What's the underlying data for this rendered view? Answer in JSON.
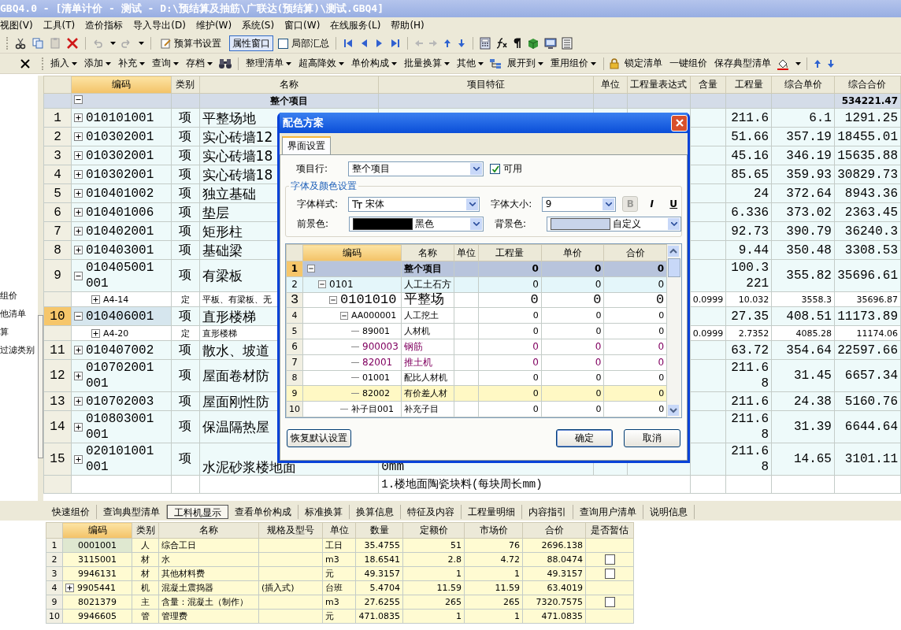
{
  "window": {
    "title": "GBQ4.0 - [清单计价 - 测试 - D:\\预结算及抽筋\\广联达(预结算)\\测试.GBQ4]"
  },
  "menu": [
    "视图(V)",
    "工具(T)",
    "造价指标",
    "导入导出(D)",
    "维护(W)",
    "系统(S)",
    "窗口(W)",
    "在线服务(L)",
    "帮助(H)"
  ],
  "toolbar1": {
    "budget_settings": "预算书设置",
    "properties_window": {
      "label": "属性窗口",
      "pressed": true
    },
    "partial_summary": {
      "label": "局部汇总",
      "checked": false
    }
  },
  "toolbar2": {
    "group1": [
      {
        "label": "插入",
        "dropdown": true
      },
      {
        "label": "添加",
        "dropdown": true
      },
      {
        "label": "补充",
        "dropdown": true
      },
      {
        "label": "查询",
        "dropdown": true
      },
      {
        "label": "存档",
        "dropdown": true
      }
    ],
    "group2": [
      {
        "label": "整理清单",
        "dropdown": true
      },
      {
        "label": "超高降效",
        "dropdown": true
      },
      {
        "label": "单价构成",
        "dropdown": true
      },
      {
        "label": "批量换算",
        "dropdown": true
      },
      {
        "label": "其他",
        "dropdown": true
      }
    ],
    "expand": {
      "label": "展开到",
      "dropdown": true
    },
    "reuse": {
      "label": "重用组价",
      "dropdown": true
    },
    "lock": "锁定清单",
    "one_key": "一键组价",
    "save_typical": "保存典型清单"
  },
  "sidebar": [
    "组价",
    "他清单",
    "算",
    "过滤类别"
  ],
  "bill": {
    "columns": [
      {
        "label": "编码",
        "selected": true
      },
      {
        "label": "类别",
        "selected": false
      },
      {
        "label": "名称",
        "selected": false
      },
      {
        "label": "项目特征",
        "selected": false
      },
      {
        "label": "单位",
        "selected": false
      },
      {
        "label": "工程量表达式",
        "selected": false
      },
      {
        "label": "含量",
        "selected": false
      },
      {
        "label": "工程量",
        "selected": false
      },
      {
        "label": "综合单价",
        "selected": false
      },
      {
        "label": "综合合价",
        "selected": false
      }
    ],
    "root": {
      "name": "整个项目",
      "total": "534221.47",
      "expanded": true,
      "children": [
        {
          "kind": "item",
          "num": "1",
          "code": "010101001",
          "type": "项",
          "name": "平整场地",
          "qty": "211.6",
          "price": "6.1",
          "total": "1291.25",
          "expanded": false,
          "selected": false
        },
        {
          "kind": "item",
          "num": "2",
          "code": "010302001",
          "type": "项",
          "name": "实心砖墙12",
          "qty": "51.66",
          "price": "357.19",
          "total": "18455.01",
          "expanded": false,
          "selected": false
        },
        {
          "kind": "item",
          "num": "3",
          "code": "010302001",
          "type": "项",
          "name": "实心砖墙18",
          "qty": "45.16",
          "price": "346.19",
          "total": "15635.88",
          "expanded": false,
          "selected": false
        },
        {
          "kind": "item",
          "num": "4",
          "code": "010302001",
          "type": "项",
          "name": "实心砖墙18",
          "qty": "85.65",
          "price": "359.93",
          "total": "30829.73",
          "expanded": false,
          "selected": false
        },
        {
          "kind": "item",
          "num": "5",
          "code": "010401002",
          "type": "项",
          "name": "独立基础",
          "qty": "24",
          "price": "372.64",
          "total": "8943.36",
          "expanded": false,
          "selected": false
        },
        {
          "kind": "item",
          "num": "6",
          "code": "010401006",
          "type": "项",
          "name": "垫层",
          "qty": "6.336",
          "price": "373.02",
          "total": "2363.45",
          "expanded": false,
          "selected": false
        },
        {
          "kind": "item",
          "num": "7",
          "code": "010402001",
          "type": "项",
          "name": "矩形柱",
          "qty": "92.73",
          "price": "390.79",
          "total": "36240.3",
          "expanded": false,
          "selected": false
        },
        {
          "kind": "item",
          "num": "8",
          "code": "010403001",
          "type": "项",
          "name": "基础梁",
          "qty": "9.44",
          "price": "350.48",
          "total": "3308.53",
          "expanded": false,
          "selected": false
        },
        {
          "kind": "item",
          "num": "9",
          "code": "010405001001",
          "type": "项",
          "name": "有梁板",
          "qty": "100.3221",
          "price": "355.82",
          "total": "35696.61",
          "expanded": true,
          "selected": false,
          "children": [
            {
              "kind": "sub",
              "code": "A4-14",
              "type": "定",
              "name": "平板、有梁板、无",
              "content": "0.0999",
              "qty": "10.032",
              "price": "3558.3",
              "total": "35696.87",
              "expanded": false
            }
          ]
        },
        {
          "kind": "item",
          "num": "10",
          "code": "010406001",
          "type": "项",
          "name": "直形楼梯",
          "qty": "27.35",
          "price": "408.51",
          "total": "11173.89",
          "expanded": true,
          "selected": true,
          "children": [
            {
              "kind": "sub",
              "code": "A4-20",
              "type": "定",
              "name": "直形楼梯",
              "content": "0.0999",
              "qty": "2.7352",
              "price": "4085.28",
              "total": "11174.06",
              "expanded": false
            }
          ]
        },
        {
          "kind": "item",
          "num": "11",
          "code": "010407002",
          "type": "项",
          "name": "散水、坡道",
          "qty": "63.72",
          "price": "354.64",
          "total": "22597.66",
          "expanded": false,
          "selected": false
        },
        {
          "kind": "item",
          "num": "12",
          "code": "010702001001",
          "type": "项",
          "name": "屋面卷材防",
          "qty": "211.68",
          "price": "31.45",
          "total": "6657.34",
          "expanded": false,
          "selected": false
        },
        {
          "kind": "item",
          "num": "13",
          "code": "010702003",
          "type": "项",
          "name": "屋面刚性防",
          "qty": "211.6",
          "price": "24.38",
          "total": "5160.76",
          "expanded": false,
          "selected": false
        },
        {
          "kind": "item",
          "num": "14",
          "code": "010803001001",
          "type": "项",
          "name": "保温隔热屋",
          "qty": "211.68",
          "price": "31.39",
          "total": "6644.64",
          "expanded": false,
          "selected": false
        },
        {
          "kind": "item",
          "num": "15",
          "code": "020101001001",
          "type": "项",
          "name": "水泥砂浆楼地面",
          "feature": "0mm",
          "qty": "211.68",
          "price": "14.65",
          "total": "3101.11",
          "expanded": false,
          "selected": false
        },
        {
          "kind": "note",
          "feature": "1.楼地面陶瓷块料(每块周长mm)"
        }
      ]
    }
  },
  "dialog": {
    "title": "配色方案",
    "tabs": [
      {
        "label": "界面设置",
        "selected": true
      }
    ],
    "row_type": {
      "label": "项目行:",
      "value": "整个项目"
    },
    "enabled": {
      "label": "可用",
      "checked": true
    },
    "group_title": "字体及颜色设置",
    "font": {
      "label": "字体样式:",
      "value": "宋体"
    },
    "size": {
      "label": "字体大小:",
      "value": "9"
    },
    "bold": {
      "label": "B",
      "disabled": true
    },
    "italic": {
      "label": "I",
      "disabled": false
    },
    "underline": {
      "label": "U",
      "disabled": false
    },
    "fore": {
      "label": "前景色:",
      "value": "黑色",
      "color": "#000000"
    },
    "back": {
      "label": "背景色:",
      "value": "自定义",
      "color": "#c8d4ea"
    },
    "preview": {
      "columns": [
        {
          "label": "编码",
          "selected": true
        },
        {
          "label": "名称",
          "selected": false
        },
        {
          "label": "单位",
          "selected": false
        },
        {
          "label": "工程量",
          "selected": false
        },
        {
          "label": "单价",
          "selected": false
        },
        {
          "label": "合价",
          "selected": false
        }
      ],
      "rows": [
        {
          "kind": "project",
          "num": "1",
          "name": "整个项目",
          "qty": "0",
          "price": "0",
          "total": "0",
          "expanded": true,
          "selected": false,
          "children": [
            {
              "kind": "section",
              "num": "2",
              "code": "0101",
              "name": "人工土石方",
              "qty": "0",
              "price": "0",
              "total": "0",
              "expanded": true,
              "selected": false,
              "children": [
                {
                  "kind": "item",
                  "num": "3",
                  "code": "0101010",
                  "name": "平整场",
                  "qty": "0",
                  "price": "0",
                  "total": "0",
                  "expanded": true,
                  "selected": false,
                  "children": [
                    {
                      "kind": "row",
                      "num": "4",
                      "code": "AA000001",
                      "name": "人工挖土",
                      "qty": "0",
                      "price": "0",
                      "total": "0",
                      "expanded": true,
                      "selected": false,
                      "children": [
                        {
                          "kind": "row",
                          "num": "5",
                          "code": "89001",
                          "name": "人材机",
                          "qty": "0",
                          "price": "0",
                          "total": "0",
                          "selected": false
                        },
                        {
                          "kind": "main_material",
                          "num": "6",
                          "code": "900003",
                          "name": "钢筋",
                          "qty": "0",
                          "price": "0",
                          "total": "0",
                          "selected": false
                        },
                        {
                          "kind": "main_material",
                          "num": "7",
                          "code": "82001",
                          "name": "推土机",
                          "qty": "0",
                          "price": "0",
                          "total": "0",
                          "selected": false
                        },
                        {
                          "kind": "row",
                          "num": "8",
                          "code": "01001",
                          "name": "配比人材机",
                          "qty": "0",
                          "price": "0",
                          "total": "0",
                          "selected": false
                        },
                        {
                          "kind": "row",
                          "num": "9",
                          "code": "82002",
                          "name": "有价差人材",
                          "qty": "0",
                          "price": "0",
                          "total": "0",
                          "selected": true
                        }
                      ]
                    },
                    {
                      "kind": "row",
                      "num": "10",
                      "code": "补子目001",
                      "name": "补充子目",
                      "qty": "0",
                      "price": "0",
                      "total": "0",
                      "selected": false
                    }
                  ]
                }
              ]
            }
          ]
        }
      ]
    },
    "buttons": {
      "reset": "恢复默认设置",
      "ok": "确定",
      "cancel": "取消"
    }
  },
  "detail_tabs": [
    {
      "label": "快速组价",
      "selected": false
    },
    {
      "label": "查询典型清单",
      "selected": false
    },
    {
      "label": "工料机显示",
      "selected": true
    },
    {
      "label": "查看单价构成",
      "selected": false
    },
    {
      "label": "标准换算",
      "selected": false
    },
    {
      "label": "换算信息",
      "selected": false
    },
    {
      "label": "特征及内容",
      "selected": false
    },
    {
      "label": "工程量明细",
      "selected": false
    },
    {
      "label": "内容指引",
      "selected": false
    },
    {
      "label": "查询用户清单",
      "selected": false
    },
    {
      "label": "说明信息",
      "selected": false
    }
  ],
  "resources": {
    "columns": [
      {
        "label": "编码",
        "selected": true
      },
      {
        "label": "类别",
        "selected": false
      },
      {
        "label": "名称",
        "selected": false
      },
      {
        "label": "规格及型号",
        "selected": false
      },
      {
        "label": "单位",
        "selected": false
      },
      {
        "label": "数量",
        "selected": false
      },
      {
        "label": "定额价",
        "selected": false
      },
      {
        "label": "市场价",
        "selected": false
      },
      {
        "label": "合价",
        "selected": false
      },
      {
        "label": "是否暂估",
        "selected": false
      }
    ],
    "rows": [
      {
        "num": "1",
        "code": "0001001",
        "type": "人",
        "name": "综合工日",
        "unit": "工日",
        "qty": "35.4755",
        "base": "51",
        "market": "76",
        "total": "2696.138",
        "selected": true
      },
      {
        "num": "2",
        "code": "3115001",
        "type": "材",
        "name": "水",
        "unit": "m3",
        "qty": "18.6541",
        "base": "2.8",
        "market": "4.72",
        "total": "88.0474",
        "selected": false,
        "estimate": {
          "checked": false
        }
      },
      {
        "num": "3",
        "code": "9946131",
        "type": "材",
        "name": "其他材料费",
        "unit": "元",
        "qty": "49.3157",
        "base": "1",
        "market": "1",
        "total": "49.3157",
        "selected": false,
        "estimate": {
          "checked": false
        }
      },
      {
        "num": "4",
        "code": "9905441",
        "type": "机",
        "name": "混凝土震捣器",
        "spec": "(插入式)",
        "unit": "台班",
        "qty": "5.4704",
        "base": "11.59",
        "market": "11.59",
        "total": "63.4019",
        "selected": false,
        "expanded": false
      },
      {
        "num": "9",
        "code": "8021379",
        "type": "主",
        "name": "含量：混凝土（制作）",
        "unit": "m3",
        "qty": "27.6255",
        "base": "265",
        "market": "265",
        "total": "7320.7575",
        "selected": false,
        "estimate": {
          "checked": false
        }
      },
      {
        "num": "10",
        "code": "9946605",
        "type": "管",
        "name": "管理费",
        "unit": "元",
        "qty": "471.0835",
        "base": "1",
        "market": "1",
        "total": "471.0835",
        "selected": false
      }
    ]
  }
}
